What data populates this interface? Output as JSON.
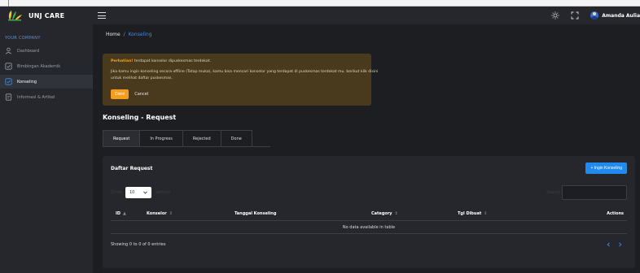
{
  "brand": {
    "title": "UNJ CARE"
  },
  "sidebar": {
    "section_label": "YOUR COMPANY",
    "items": [
      {
        "label": "Dashboard",
        "icon": "user-icon",
        "active": false
      },
      {
        "label": "Bimbingan Akademik",
        "icon": "checkbox-icon",
        "active": false
      },
      {
        "label": "Konseling",
        "icon": "chat-icon",
        "active": true
      },
      {
        "label": "Informasi & Artikel",
        "icon": "document-icon",
        "active": false
      }
    ]
  },
  "topbar": {
    "user_name": "Amanda Aulia"
  },
  "breadcrumb": {
    "home": "Home",
    "separator": "/",
    "current": "Konseling"
  },
  "alert": {
    "strong": "Perhatian!",
    "line1_rest": " terdapat konselor dipuskesmas terdekat.",
    "line2": "Jika kamu ingin konseling secara offline (Tatap muka), kamu bisa mencari konselor yang terdapat di puskesmas terdekat mu. berikut klik disini untuk melihat daftar puskesmas.",
    "primary_label": "Disini",
    "cancel_label": "Cancel"
  },
  "page_title": "Konseling - Request",
  "tabs": [
    {
      "label": "Request",
      "active": true
    },
    {
      "label": "In Progress",
      "active": false
    },
    {
      "label": "Rejected",
      "active": false
    },
    {
      "label": "Done",
      "active": false
    }
  ],
  "card": {
    "title": "Daftar Request",
    "add_button": "+ Ingin Konseling",
    "length_label": "Show",
    "length_value": "10",
    "length_after": "entries",
    "search_label": "Search:",
    "search_value": "",
    "columns": [
      {
        "label": "ID",
        "sort": "▲"
      },
      {
        "label": "Konselor",
        "sort": "⇕"
      },
      {
        "label": "Tanggal Konseling",
        "sort": ""
      },
      {
        "label": "Category",
        "sort": "⇕"
      },
      {
        "label": "Tgl Dibuat",
        "sort": "⇕"
      },
      {
        "label": "Actions",
        "sort": ""
      }
    ],
    "empty_text": "No data available in table",
    "info_text": "Showing 0 to 0 of 0 entries"
  },
  "colors": {
    "accent": "#1f8bf0",
    "warning": "#f39c1e",
    "link": "#3f8fea"
  }
}
